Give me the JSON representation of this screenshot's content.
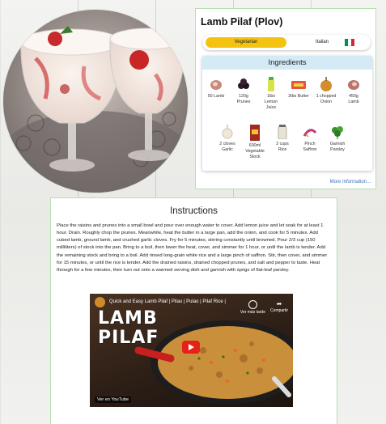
{
  "recipe": {
    "title": "Lamb Pilaf (Plov)",
    "diet_label": "Vegetarian",
    "cuisine_label": "Italian",
    "flag_colors": [
      "#009246",
      "#ffffff",
      "#ce2b37"
    ]
  },
  "ingredients": {
    "heading": "Ingredients",
    "items": [
      {
        "icon": "lamb-icon",
        "label": "50 Lamb"
      },
      {
        "icon": "prunes-icon",
        "label": "120g Prunes"
      },
      {
        "icon": "lemon-juice-icon",
        "label": "1tbs Lemon Juice"
      },
      {
        "icon": "butter-icon",
        "label": "2tbs Butter"
      },
      {
        "icon": "onion-icon",
        "label": "1 chopped Onion"
      },
      {
        "icon": "lamb-icon",
        "label": "450g Lamb"
      },
      {
        "icon": "garlic-icon",
        "label": "2 cloves Garlic"
      },
      {
        "icon": "stock-icon",
        "label": "600ml Vegetable Stock"
      },
      {
        "icon": "rice-icon",
        "label": "2 cups Rice"
      },
      {
        "icon": "saffron-icon",
        "label": "Pinch Saffron"
      },
      {
        "icon": "parsley-icon",
        "label": "Garnish Parsley"
      }
    ],
    "more_link": "More Information..."
  },
  "instructions": {
    "heading": "Instructions",
    "body": "Place the raisins and prunes into a small bowl and pour over enough water to cover. Add lemon juice and let soak for at least 1 hour. Drain. Roughly chop the prunes. Meanwhile, heat the butter in a large pan, add the onion, and cook for 5 minutes. Add cubed lamb, ground lamb, and crushed garlic cloves. Fry for 5 minutes, stirring constantly until browned. Pour 2/3 cup (150 milliliters) of stock into the pan. Bring to a boil, then lower the heat, cover, and simmer for 1 hour, or until the lamb is tender. Add the remaining stock and bring to a boil. Add rinsed long-grain white rice and a large pinch of saffron. Stir, then cover, and simmer for 15 minutes, or until the rice is tender. Add the drained raisins, drained chopped prunes, and salt and pepper to taste. Heat through for a few minutes, then turn out onto a warmed serving dish and garnish with sprigs of flat-leaf parsley."
  },
  "video": {
    "title": "Quick and Easy Lamb Pilaf | Pilau | Pulao | Pilaf Rice |",
    "overlay_line1": "LAMB",
    "overlay_line2": "PILAF",
    "watch_later": "Ver más tarde",
    "share": "Compartir",
    "youtube_badge": "Ver en YouTube"
  }
}
